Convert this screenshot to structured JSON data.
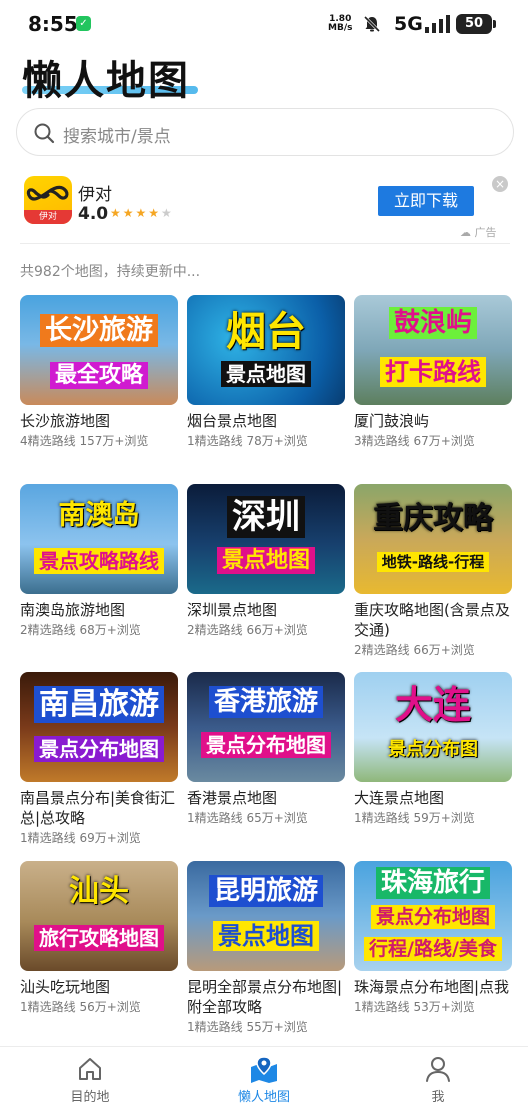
{
  "status": {
    "time": "8:55",
    "net_speed_value": "1.80",
    "net_speed_unit": "MB/s",
    "net_type": "5G",
    "battery": "50"
  },
  "header": {
    "title": "懒人地图",
    "search_placeholder": "搜索城市/景点"
  },
  "ad": {
    "app_name": "伊对",
    "rating": "4.0",
    "stars": 4,
    "icon_label": "伊对",
    "download_label": "立即下载",
    "ad_label": "广告"
  },
  "count_text": "共982个地图，持续更新中...",
  "cards": [
    {
      "title": "长沙旅游地图",
      "meta": "4精选路线 157万+浏览",
      "thumb_lines": [
        "长沙旅游",
        "最全攻略"
      ]
    },
    {
      "title": "烟台景点地图",
      "meta": "1精选路线 78万+浏览",
      "thumb_lines": [
        "烟台",
        "景点地图"
      ]
    },
    {
      "title": "厦门鼓浪屿",
      "meta": "3精选路线 67万+浏览",
      "thumb_lines": [
        "鼓浪屿",
        "打卡路线"
      ]
    },
    {
      "title": "南澳岛旅游地图",
      "meta": "2精选路线 68万+浏览",
      "thumb_lines": [
        "南澳岛",
        "景点攻略路线"
      ]
    },
    {
      "title": "深圳景点地图",
      "meta": "2精选路线 66万+浏览",
      "thumb_lines": [
        "深圳",
        "景点地图"
      ]
    },
    {
      "title": "重庆攻略地图(含景点及交通)",
      "meta": "2精选路线 66万+浏览",
      "thumb_lines": [
        "重庆攻略",
        "地铁-路线-行程"
      ]
    },
    {
      "title": "南昌景点分布|美食街汇总|总攻略",
      "meta": "1精选路线 69万+浏览",
      "thumb_lines": [
        "南昌旅游",
        "景点分布地图"
      ]
    },
    {
      "title": "香港景点地图",
      "meta": "1精选路线 65万+浏览",
      "thumb_lines": [
        "香港旅游",
        "景点分布地图"
      ]
    },
    {
      "title": "大连景点地图",
      "meta": "1精选路线 59万+浏览",
      "thumb_lines": [
        "大连",
        "景点分布图"
      ]
    },
    {
      "title": "汕头吃玩地图",
      "meta": "1精选路线 56万+浏览",
      "thumb_lines": [
        "汕头",
        "旅行攻略地图"
      ]
    },
    {
      "title": "昆明全部景点分布地图|附全部攻略",
      "meta": "1精选路线 55万+浏览",
      "thumb_lines": [
        "昆明旅游",
        "景点地图"
      ]
    },
    {
      "title": "珠海景点分布地图|点我",
      "meta": "1精选路线 53万+浏览",
      "thumb_lines": [
        "珠海旅行",
        "景点分布地图",
        "行程/路线/美食"
      ]
    }
  ],
  "bottom_nav": [
    {
      "label": "目的地",
      "icon": "home-icon",
      "active": false
    },
    {
      "label": "懒人地图",
      "icon": "map-pin-icon",
      "active": true
    },
    {
      "label": "我",
      "icon": "person-icon",
      "active": false
    }
  ],
  "colors": {
    "accent": "#1e88e5",
    "download": "#1e7ae0"
  }
}
